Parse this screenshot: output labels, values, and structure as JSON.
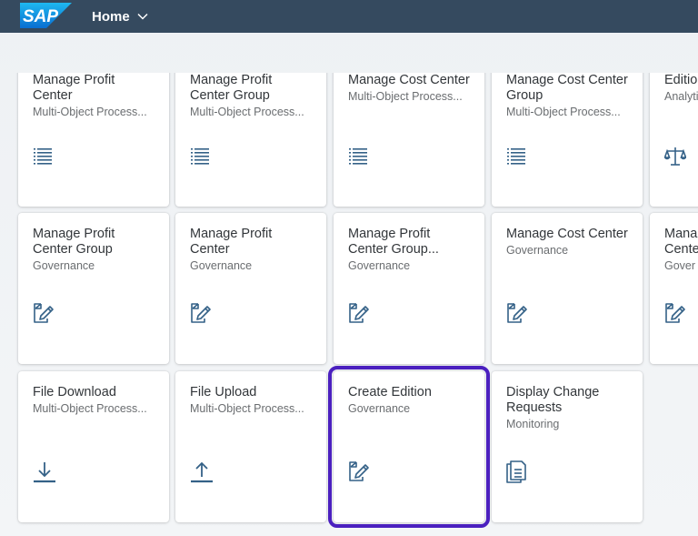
{
  "shell": {
    "logo_text": "SAP",
    "home_label": "Home"
  },
  "rows": [
    {
      "tiles": [
        {
          "title": "Manage Profit Center",
          "subtitle": "Multi-Object Process...",
          "icon": "list-icon"
        },
        {
          "title": "Manage Profit Center Group",
          "subtitle": "Multi-Object Process...",
          "icon": "list-icon"
        },
        {
          "title": "Manage Cost Center",
          "subtitle": "Multi-Object Process...",
          "icon": "list-icon"
        },
        {
          "title": "Manage Cost Center Group",
          "subtitle": "Multi-Object Process...",
          "icon": "list-icon"
        },
        {
          "title": "Editio",
          "subtitle": "Analyti",
          "icon": "balance-scale-icon"
        }
      ]
    },
    {
      "tiles": [
        {
          "title": "Manage Profit Center Group",
          "subtitle": "Governance",
          "icon": "edit-document-icon"
        },
        {
          "title": "Manage Profit Center",
          "subtitle": "Governance",
          "icon": "edit-document-icon"
        },
        {
          "title": "Manage Profit Center Group...",
          "subtitle": "Governance",
          "icon": "edit-document-icon"
        },
        {
          "title": "Manage Cost Center",
          "subtitle": "Governance",
          "icon": "edit-document-icon"
        },
        {
          "title": "Mana Cente",
          "subtitle": "Gover",
          "icon": "edit-document-icon"
        }
      ]
    },
    {
      "tiles": [
        {
          "title": "File Download",
          "subtitle": "Multi-Object Process...",
          "icon": "download-icon"
        },
        {
          "title": "File Upload",
          "subtitle": "Multi-Object Process...",
          "icon": "upload-icon"
        },
        {
          "title": "Create Edition",
          "subtitle": "Governance",
          "icon": "edit-document-icon"
        },
        {
          "title": "Display Change Requests",
          "subtitle": "Monitoring",
          "icon": "documents-icon"
        }
      ]
    }
  ],
  "colors": {
    "shell_bg": "#354a5f",
    "icon": "#346187",
    "highlight_border": "#4b20bf"
  }
}
